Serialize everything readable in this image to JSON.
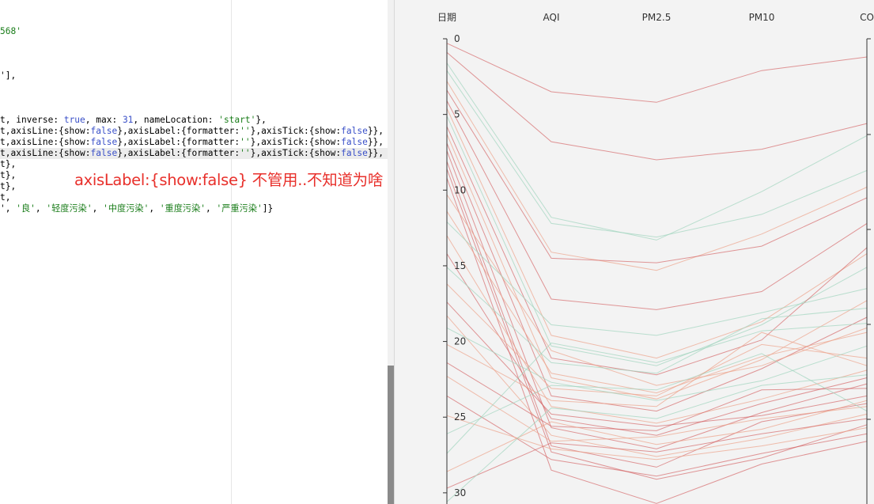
{
  "editor": {
    "lines": [
      {
        "segments": [
          {
            "text": "568'",
            "cls": "str"
          }
        ]
      },
      {
        "segments": [
          {
            "text": "'],",
            "cls": ""
          }
        ]
      },
      {
        "segments": [
          {
            "text": "t, inverse: ",
            "cls": ""
          },
          {
            "text": "true",
            "cls": "kw"
          },
          {
            "text": ", max: ",
            "cls": ""
          },
          {
            "text": "31",
            "cls": "kw"
          },
          {
            "text": ", nameLocation: ",
            "cls": ""
          },
          {
            "text": "'start'",
            "cls": "str"
          },
          {
            "text": "},",
            "cls": ""
          }
        ]
      },
      {
        "segments": [
          {
            "text": "t,axisLine:{show:",
            "cls": ""
          },
          {
            "text": "false",
            "cls": "kw"
          },
          {
            "text": "},axisLabel:{formatter:",
            "cls": ""
          },
          {
            "text": "''",
            "cls": "str"
          },
          {
            "text": "},axisTick:{show:",
            "cls": ""
          },
          {
            "text": "false",
            "cls": "kw"
          },
          {
            "text": "}},",
            "cls": ""
          }
        ]
      },
      {
        "segments": [
          {
            "text": "t,axisLine:{show:",
            "cls": ""
          },
          {
            "text": "false",
            "cls": "kw"
          },
          {
            "text": "},axisLabel:{formatter:",
            "cls": ""
          },
          {
            "text": "''",
            "cls": "str"
          },
          {
            "text": "},axisTick:{show:",
            "cls": ""
          },
          {
            "text": "false",
            "cls": "kw"
          },
          {
            "text": "}},",
            "cls": ""
          }
        ]
      },
      {
        "segments": [
          {
            "text": "t,axisLine:{show:",
            "cls": ""
          },
          {
            "text": "false",
            "cls": "kw"
          },
          {
            "text": "},axisLabel:{formatter:",
            "cls": ""
          },
          {
            "text": "''",
            "cls": "str"
          },
          {
            "text": "},axisTick:{show:",
            "cls": ""
          },
          {
            "text": "false",
            "cls": "kw"
          },
          {
            "text": "}},",
            "cls": ""
          }
        ],
        "highlight": true
      },
      {
        "segments": [
          {
            "text": "t},",
            "cls": ""
          }
        ]
      },
      {
        "segments": [
          {
            "text": "t},",
            "cls": ""
          }
        ]
      },
      {
        "segments": [
          {
            "text": "t},",
            "cls": ""
          }
        ]
      },
      {
        "segments": [
          {
            "text": "t,",
            "cls": ""
          }
        ]
      },
      {
        "segments": [
          {
            "text": "', ",
            "cls": ""
          },
          {
            "text": "'良'",
            "cls": "str"
          },
          {
            "text": ", ",
            "cls": ""
          },
          {
            "text": "'轻度污染'",
            "cls": "str"
          },
          {
            "text": ", ",
            "cls": ""
          },
          {
            "text": "'中度污染'",
            "cls": "str"
          },
          {
            "text": ", ",
            "cls": ""
          },
          {
            "text": "'重度污染'",
            "cls": "str"
          },
          {
            "text": ", ",
            "cls": ""
          },
          {
            "text": "'严重污染'",
            "cls": "str"
          },
          {
            "text": "]}",
            "cls": ""
          }
        ]
      }
    ],
    "annotation": "axisLabel:{show:false} 不管用..不知道为啥"
  },
  "chart_data": {
    "type": "parallel",
    "axes": [
      "日期",
      "AQI",
      "PM2.5",
      "PM10",
      "CO"
    ],
    "date_axis": {
      "ticks": [
        0,
        5,
        10,
        15,
        20,
        25,
        30
      ],
      "max": 31,
      "inverse": true
    },
    "colors": {
      "background": "#f3f3f3",
      "axis": "#333333",
      "good": "#9fd4be",
      "mild": "#eca28a",
      "bad": "#d2585a"
    },
    "series": [
      {
        "values": [
          0.3,
          3.5,
          4.2,
          2.1,
          1.2
        ],
        "level": "bad"
      },
      {
        "values": [
          0.9,
          6.8,
          8.0,
          7.3,
          5.6
        ],
        "level": "bad"
      },
      {
        "values": [
          1.6,
          11.8,
          13.3,
          10.1,
          6.4
        ],
        "level": "good"
      },
      {
        "values": [
          2.1,
          12.2,
          13.1,
          11.6,
          8.7
        ],
        "level": "good"
      },
      {
        "values": [
          2.8,
          14.1,
          15.3,
          12.9,
          9.8
        ],
        "level": "mild"
      },
      {
        "values": [
          3.4,
          14.5,
          14.8,
          13.7,
          10.5
        ],
        "level": "bad"
      },
      {
        "values": [
          4.1,
          17.2,
          17.9,
          16.7,
          12.2
        ],
        "level": "bad"
      },
      {
        "values": [
          4.6,
          19.6,
          21.1,
          18.7,
          14.2
        ],
        "level": "mild"
      },
      {
        "values": [
          5.1,
          20.3,
          21.6,
          18.9,
          15.1
        ],
        "level": "good"
      },
      {
        "values": [
          5.8,
          21.1,
          22.2,
          19.9,
          13.8
        ],
        "level": "bad"
      },
      {
        "values": [
          6.3,
          22.4,
          23.8,
          21.2,
          17.3
        ],
        "level": "mild"
      },
      {
        "values": [
          6.9,
          23.6,
          24.6,
          21.8,
          18.4
        ],
        "level": "bad"
      },
      {
        "values": [
          7.4,
          25.7,
          27.1,
          24.7,
          22.8
        ],
        "level": "bad"
      },
      {
        "values": [
          8.1,
          26.9,
          28.3,
          25.3,
          24.1
        ],
        "level": "bad"
      },
      {
        "values": [
          8.6,
          27.3,
          29.1,
          27.7,
          25.5
        ],
        "level": "bad"
      },
      {
        "values": [
          9.2,
          28.5,
          30.7,
          28.1,
          26.6
        ],
        "level": "bad"
      },
      {
        "values": [
          10.3,
          20.6,
          22.9,
          21.6,
          19.1
        ],
        "level": "mild"
      },
      {
        "values": [
          11.4,
          22.1,
          23.4,
          21.0,
          19.4
        ],
        "level": "mild"
      },
      {
        "values": [
          12.1,
          18.9,
          19.6,
          18.1,
          16.5
        ],
        "level": "good"
      },
      {
        "values": [
          13.0,
          24.3,
          25.4,
          23.8,
          21.9
        ],
        "level": "mild"
      },
      {
        "values": [
          14.2,
          25.1,
          26.2,
          24.1,
          22.4
        ],
        "level": "bad"
      },
      {
        "values": [
          15.1,
          21.4,
          22.1,
          18.5,
          17.8
        ],
        "level": "good"
      },
      {
        "values": [
          16.2,
          23.1,
          23.6,
          20.2,
          21.1
        ],
        "level": "mild"
      },
      {
        "values": [
          17.4,
          24.8,
          25.6,
          24.9,
          23.6
        ],
        "level": "bad"
      },
      {
        "values": [
          18.3,
          26.2,
          27.6,
          26.4,
          24.8
        ],
        "level": "mild"
      },
      {
        "values": [
          19.1,
          22.7,
          23.9,
          22.6,
          20.3
        ],
        "level": "good"
      },
      {
        "values": [
          20.2,
          23.9,
          24.3,
          19.4,
          21.6
        ],
        "level": "mild"
      },
      {
        "values": [
          21.4,
          25.6,
          25.9,
          23.2,
          23.1
        ],
        "level": "bad"
      },
      {
        "values": [
          22.3,
          26.6,
          26.3,
          25.1,
          24.3
        ],
        "level": "mild"
      },
      {
        "values": [
          23.6,
          27.8,
          28.9,
          27.4,
          26.1
        ],
        "level": "bad"
      },
      {
        "values": [
          24.9,
          27.1,
          27.8,
          26.9,
          25.7
        ],
        "level": "mild"
      },
      {
        "values": [
          26.1,
          22.9,
          23.2,
          20.8,
          24.6
        ],
        "level": "good"
      },
      {
        "values": [
          27.4,
          20.1,
          21.4,
          19.3,
          18.8
        ],
        "level": "good"
      },
      {
        "values": [
          28.6,
          25.3,
          26.8,
          25.8,
          23.9
        ],
        "level": "mild"
      },
      {
        "values": [
          29.7,
          26.7,
          27.3,
          26.1,
          25.1
        ],
        "level": "bad"
      },
      {
        "values": [
          30.6,
          24.4,
          25.1,
          22.9,
          22.2
        ],
        "level": "good"
      }
    ]
  }
}
